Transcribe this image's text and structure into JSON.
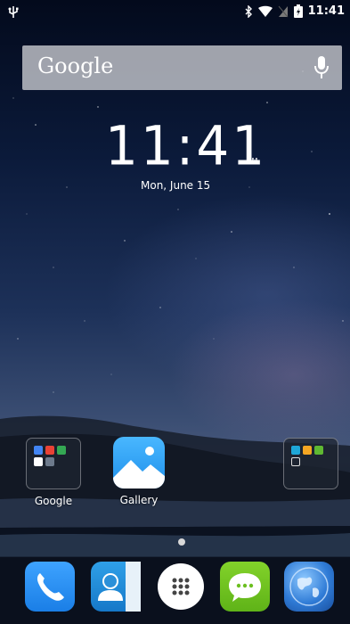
{
  "status_bar": {
    "time": "11:41",
    "icons": [
      "usb-icon",
      "bluetooth-icon",
      "wifi-icon",
      "no-sim-icon",
      "battery-charging-icon"
    ]
  },
  "search_bar": {
    "logo_text": "Google",
    "icon": "mic-icon"
  },
  "clock_widget": {
    "time": "11:41",
    "ampm": "AM",
    "date": "Mon, June 15"
  },
  "home_apps": [
    {
      "label": "Google",
      "type": "folder"
    },
    {
      "label": "Gallery",
      "type": "app"
    },
    {
      "label": "",
      "type": "folder"
    }
  ],
  "page_indicator": {
    "pages": 1,
    "current": 1
  },
  "dock": {
    "apps": [
      "phone-icon",
      "contacts-icon",
      "app-drawer-icon",
      "messaging-icon",
      "browser-icon"
    ]
  },
  "colors": {
    "search_bar_bg": "#dcdce0",
    "gallery_blue": "#1e8fea",
    "phone_blue": "#1f8ef2",
    "messaging_green": "#71c21a"
  }
}
